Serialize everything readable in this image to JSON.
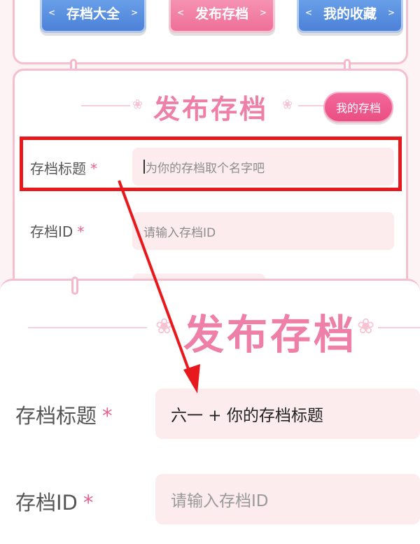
{
  "nav": {
    "buttons": [
      {
        "label": "存档大全"
      },
      {
        "label": "发布存档"
      },
      {
        "label": "我的收藏"
      }
    ],
    "deco_left": "<",
    "deco_right": ">"
  },
  "form": {
    "title": "发布存档",
    "my_archive_label": "我的存档",
    "archive_title_label": "存档标题",
    "archive_title_placeholder": "为你的存档取个名字吧",
    "archive_id_label": "存档ID",
    "archive_id_placeholder": "请输入存档ID",
    "required_mark": "*"
  },
  "zoom": {
    "title": "发布存档",
    "archive_title_label": "存档标题",
    "archive_title_value": "六一 + 你的存档标题",
    "archive_id_label": "存档ID",
    "archive_id_placeholder": "请输入存档ID",
    "required_mark": "*"
  },
  "colors": {
    "accent_pink": "#ee7fa6",
    "button_blue": "#4a7fd6",
    "button_pink": "#ee6d97",
    "highlight_red": "#e8191d",
    "field_bg": "#fceced"
  },
  "icons": {
    "petal": "petal-icon",
    "arrow": "annotation-arrow-icon"
  }
}
